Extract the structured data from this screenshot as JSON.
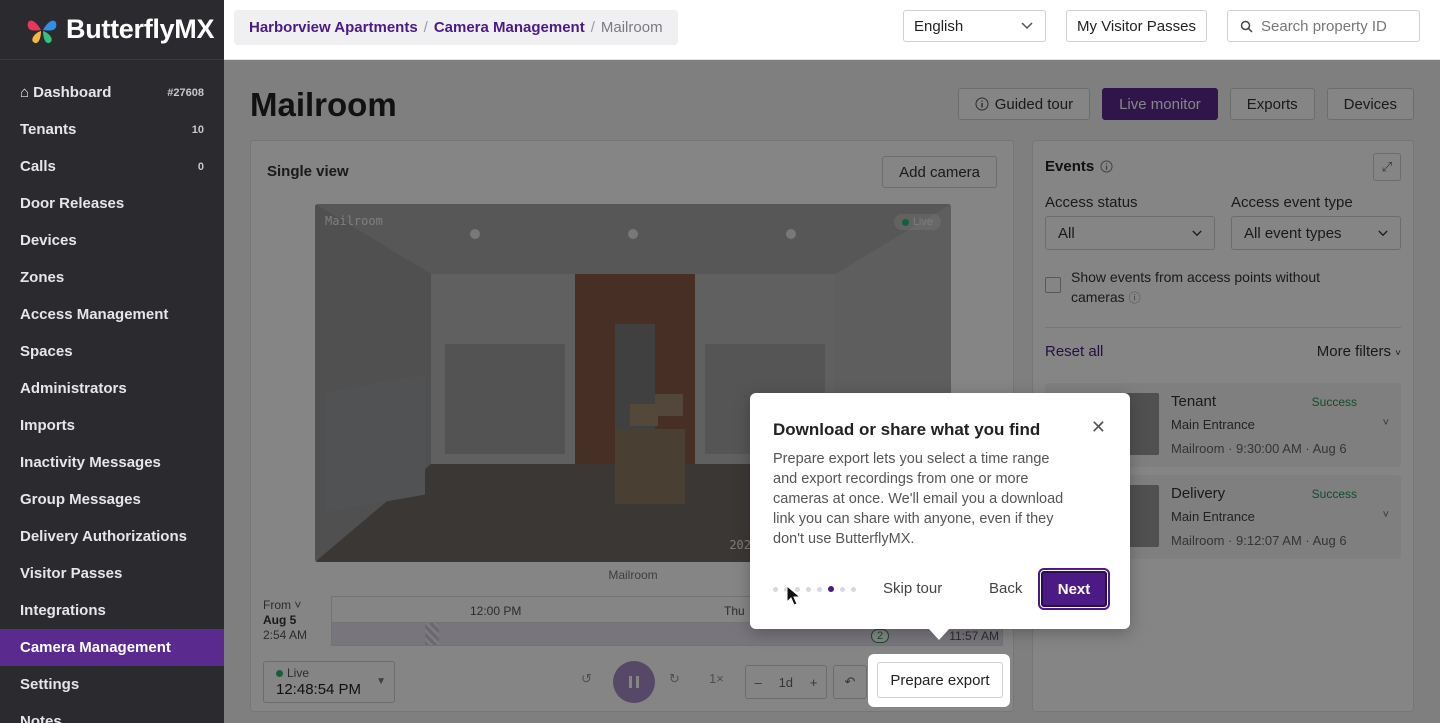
{
  "brand": {
    "name": "ButterflyMX"
  },
  "sidebar": {
    "items": [
      {
        "label": "Dashboard",
        "badge": "#27608",
        "icon": "home-icon"
      },
      {
        "label": "Tenants",
        "badge": "10"
      },
      {
        "label": "Calls",
        "badge": "0"
      },
      {
        "label": "Door Releases"
      },
      {
        "label": "Devices"
      },
      {
        "label": "Zones"
      },
      {
        "label": "Access Management"
      },
      {
        "label": "Spaces"
      },
      {
        "label": "Administrators"
      },
      {
        "label": "Imports"
      },
      {
        "label": "Inactivity Messages"
      },
      {
        "label": "Group Messages"
      },
      {
        "label": "Delivery Authorizations"
      },
      {
        "label": "Visitor Passes"
      },
      {
        "label": "Integrations"
      },
      {
        "label": "Camera Management",
        "active": true
      },
      {
        "label": "Settings"
      },
      {
        "label": "Notes"
      }
    ]
  },
  "topbar": {
    "breadcrumb": [
      "Harborview Apartments",
      "Camera Management",
      "Mailroom"
    ],
    "language": "English",
    "visitor_passes": "My Visitor Passes",
    "search_placeholder": "Search property ID"
  },
  "page": {
    "title": "Mailroom",
    "actions": {
      "guided_tour": "Guided tour",
      "live_monitor": "Live monitor",
      "exports": "Exports",
      "devices": "Devices"
    }
  },
  "camera": {
    "heading": "Single view",
    "add_camera": "Add camera",
    "feed_label": "Mailroom",
    "live": "Live",
    "timestamp_partial": "202",
    "caption": "Mailroom",
    "timeline": {
      "from_label": "From",
      "from_date": "Aug 5",
      "from_time": "2:54 AM",
      "tick_1": "12:00 PM",
      "tick_2": "Thu",
      "end_time": "11:57 AM",
      "event_count": "2"
    },
    "live_box": {
      "label": "Live",
      "time": "12:48:54 PM"
    },
    "speed": "1×",
    "zoom": "1d",
    "prepare_export": "Prepare export"
  },
  "events": {
    "title": "Events",
    "access_status_label": "Access status",
    "access_status_value": "All",
    "access_type_label": "Access event type",
    "access_type_value": "All event types",
    "checkbox_label": "Show events from access points without cameras",
    "reset": "Reset all",
    "more_filters": "More filters",
    "items": [
      {
        "name": "Tenant",
        "status": "Success",
        "location": "Main Entrance",
        "meta": "Mailroom · 9:30:00 AM · Aug 6"
      },
      {
        "name": "Delivery",
        "status": "Success",
        "location": "Main Entrance",
        "meta": "Mailroom · 9:12:07 AM · Aug 6"
      }
    ]
  },
  "tour": {
    "title": "Download or share what you find",
    "body": "Prepare export lets you select a time range and export recordings from one or more cameras at once. We'll email you a download link you can share with anyone, even if they don't use ButterflyMX.",
    "skip": "Skip tour",
    "back": "Back",
    "next": "Next",
    "steps_total": 8,
    "step_current": 6
  },
  "colors": {
    "brand_purple": "#5b2a8e",
    "link_purple": "#4b1a84",
    "success": "#2a8f5a",
    "sidebar_bg": "#2b2b2f"
  }
}
